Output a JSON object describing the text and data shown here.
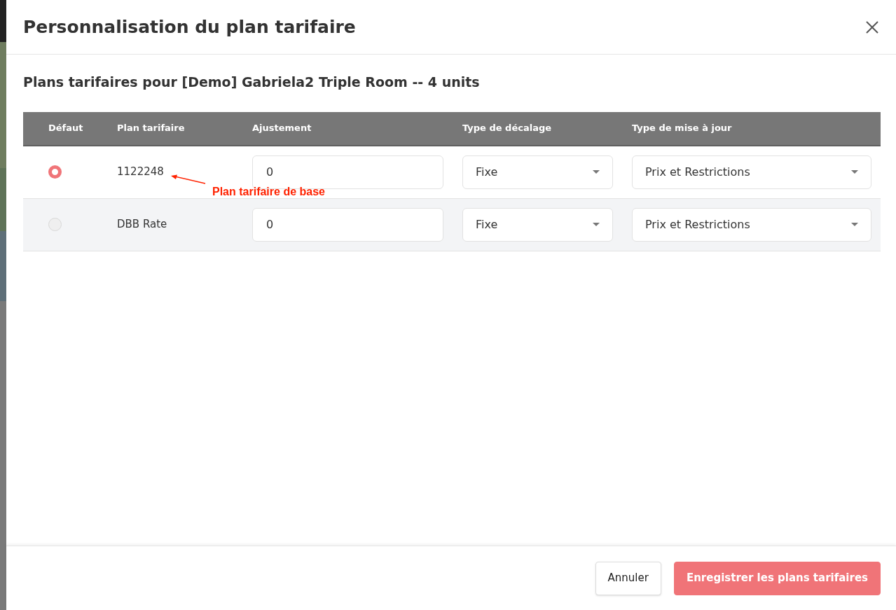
{
  "dialog": {
    "title": "Personnalisation du plan tarifaire",
    "subtitle": "Plans tarifaires pour [Demo] Gabriela2 Triple Room -- 4 units"
  },
  "table": {
    "columns": [
      "Défaut",
      "Plan tarifaire",
      "Ajustement",
      "Type de décalage",
      "Type de mise à jour"
    ],
    "rows": [
      {
        "selected": true,
        "plan": "1122248",
        "adjustment": "0",
        "offset_type": "Fixe",
        "update_type": "Prix et Restrictions",
        "annotation": "Plan tarifaire de base"
      },
      {
        "selected": false,
        "plan": "DBB Rate",
        "adjustment": "0",
        "offset_type": "Fixe",
        "update_type": "Prix et Restrictions"
      }
    ]
  },
  "footer": {
    "buttons": [
      {
        "kind": "secondary",
        "label": "Annuler"
      },
      {
        "kind": "primary",
        "label": "Enregistrer les plans tarifaires"
      }
    ]
  }
}
